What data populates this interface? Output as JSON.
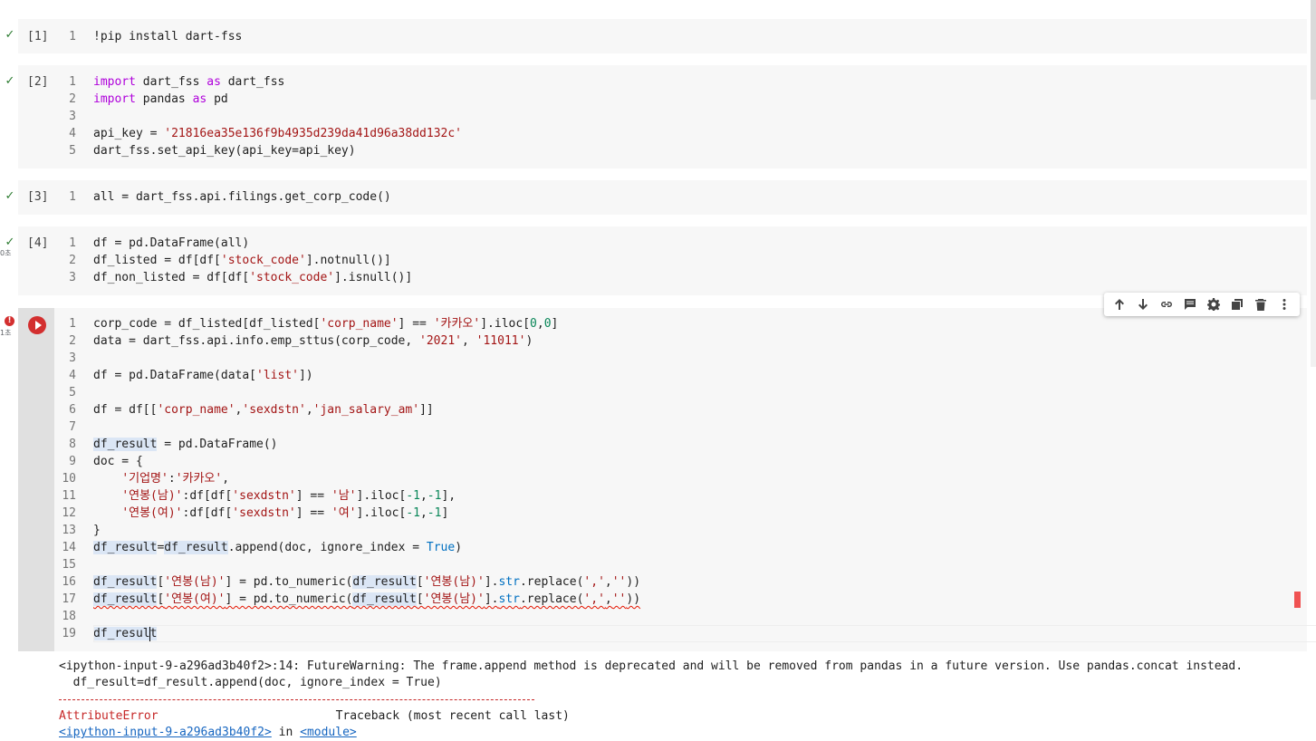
{
  "cells": [
    {
      "exec_count": "[1]",
      "status": "success",
      "lines": [
        {
          "n": "1",
          "parts": [
            {
              "t": "!pip install dart-fss",
              "c": ""
            }
          ]
        }
      ]
    },
    {
      "exec_count": "[2]",
      "status": "success",
      "lines": [
        {
          "n": "1",
          "parts": [
            {
              "t": "import",
              "c": "kw"
            },
            {
              "t": " dart_fss ",
              "c": ""
            },
            {
              "t": "as",
              "c": "kw"
            },
            {
              "t": " dart_fss",
              "c": ""
            }
          ]
        },
        {
          "n": "2",
          "parts": [
            {
              "t": "import",
              "c": "kw"
            },
            {
              "t": " pandas ",
              "c": ""
            },
            {
              "t": "as",
              "c": "kw"
            },
            {
              "t": " pd",
              "c": ""
            }
          ]
        },
        {
          "n": "3",
          "parts": []
        },
        {
          "n": "4",
          "parts": [
            {
              "t": "api_key = ",
              "c": ""
            },
            {
              "t": "'21816ea35e136f9b4935d239da41d96a38dd132c'",
              "c": "str"
            }
          ]
        },
        {
          "n": "5",
          "parts": [
            {
              "t": "dart_fss.set_api_key(api_key=api_key)",
              "c": ""
            }
          ]
        }
      ]
    },
    {
      "exec_count": "[3]",
      "status": "success",
      "lines": [
        {
          "n": "1",
          "parts": [
            {
              "t": "all = dart_fss.api.filings.get_corp_code()",
              "c": ""
            }
          ]
        }
      ]
    },
    {
      "exec_count": "[4]",
      "status": "success",
      "duration": "0초",
      "lines": [
        {
          "n": "1",
          "parts": [
            {
              "t": "df = pd.DataFrame(all)",
              "c": ""
            }
          ]
        },
        {
          "n": "2",
          "parts": [
            {
              "t": "df_listed = df[df[",
              "c": ""
            },
            {
              "t": "'stock_code'",
              "c": "str"
            },
            {
              "t": "].notnull()]",
              "c": ""
            }
          ]
        },
        {
          "n": "3",
          "parts": [
            {
              "t": "df_non_listed = df[df[",
              "c": ""
            },
            {
              "t": "'stock_code'",
              "c": "str"
            },
            {
              "t": "].isnull()]",
              "c": ""
            }
          ]
        }
      ]
    }
  ],
  "active_cell": {
    "status": "error",
    "duration": "1초",
    "lines": [
      {
        "n": "1",
        "parts": [
          {
            "t": "corp_code = df_listed[df_listed[",
            "c": ""
          },
          {
            "t": "'corp_name'",
            "c": "str"
          },
          {
            "t": "] == ",
            "c": ""
          },
          {
            "t": "'카카오'",
            "c": "str"
          },
          {
            "t": "].iloc[",
            "c": ""
          },
          {
            "t": "0",
            "c": "num"
          },
          {
            "t": ",",
            "c": ""
          },
          {
            "t": "0",
            "c": "num"
          },
          {
            "t": "]",
            "c": ""
          }
        ]
      },
      {
        "n": "2",
        "parts": [
          {
            "t": "data = dart_fss.api.info.emp_sttus(corp_code, ",
            "c": ""
          },
          {
            "t": "'2021'",
            "c": "str"
          },
          {
            "t": ", ",
            "c": ""
          },
          {
            "t": "'11011'",
            "c": "str"
          },
          {
            "t": ")",
            "c": ""
          }
        ]
      },
      {
        "n": "3",
        "parts": []
      },
      {
        "n": "4",
        "parts": [
          {
            "t": "df = pd.DataFrame(data[",
            "c": ""
          },
          {
            "t": "'list'",
            "c": "str"
          },
          {
            "t": "])",
            "c": ""
          }
        ]
      },
      {
        "n": "5",
        "parts": []
      },
      {
        "n": "6",
        "parts": [
          {
            "t": "df = df[[",
            "c": ""
          },
          {
            "t": "'corp_name'",
            "c": "str"
          },
          {
            "t": ",",
            "c": ""
          },
          {
            "t": "'sexdstn'",
            "c": "str"
          },
          {
            "t": ",",
            "c": ""
          },
          {
            "t": "'jan_salary_am'",
            "c": "str"
          },
          {
            "t": "]]",
            "c": ""
          }
        ]
      },
      {
        "n": "7",
        "parts": []
      },
      {
        "n": "8",
        "parts": [
          {
            "t": "df_result",
            "c": "hl"
          },
          {
            "t": " = pd.DataFrame()",
            "c": ""
          }
        ]
      },
      {
        "n": "9",
        "parts": [
          {
            "t": "doc = {",
            "c": ""
          }
        ]
      },
      {
        "n": "10",
        "parts": [
          {
            "t": "    ",
            "c": ""
          },
          {
            "t": "'기업명'",
            "c": "str"
          },
          {
            "t": ":",
            "c": ""
          },
          {
            "t": "'카카오'",
            "c": "str"
          },
          {
            "t": ",",
            "c": ""
          }
        ]
      },
      {
        "n": "11",
        "parts": [
          {
            "t": "    ",
            "c": ""
          },
          {
            "t": "'연봉(남)'",
            "c": "str"
          },
          {
            "t": ":df[df[",
            "c": ""
          },
          {
            "t": "'sexdstn'",
            "c": "str"
          },
          {
            "t": "] == ",
            "c": ""
          },
          {
            "t": "'남'",
            "c": "str"
          },
          {
            "t": "].iloc[",
            "c": ""
          },
          {
            "t": "-1",
            "c": "num"
          },
          {
            "t": ",",
            "c": ""
          },
          {
            "t": "-1",
            "c": "num"
          },
          {
            "t": "],",
            "c": ""
          }
        ]
      },
      {
        "n": "12",
        "parts": [
          {
            "t": "    ",
            "c": ""
          },
          {
            "t": "'연봉(여)'",
            "c": "str"
          },
          {
            "t": ":df[df[",
            "c": ""
          },
          {
            "t": "'sexdstn'",
            "c": "str"
          },
          {
            "t": "] == ",
            "c": ""
          },
          {
            "t": "'여'",
            "c": "str"
          },
          {
            "t": "].iloc[",
            "c": ""
          },
          {
            "t": "-1",
            "c": "num"
          },
          {
            "t": ",",
            "c": ""
          },
          {
            "t": "-1",
            "c": "num"
          },
          {
            "t": "]",
            "c": ""
          }
        ]
      },
      {
        "n": "13",
        "parts": [
          {
            "t": "}",
            "c": ""
          }
        ]
      },
      {
        "n": "14",
        "parts": [
          {
            "t": "df_result",
            "c": "hl"
          },
          {
            "t": "=",
            "c": ""
          },
          {
            "t": "df_result",
            "c": "hl"
          },
          {
            "t": ".append(doc, ignore_index = ",
            "c": ""
          },
          {
            "t": "True",
            "c": "bi"
          },
          {
            "t": ")",
            "c": ""
          }
        ]
      },
      {
        "n": "15",
        "parts": []
      },
      {
        "n": "16",
        "parts": [
          {
            "t": "df_result",
            "c": "hl"
          },
          {
            "t": "[",
            "c": ""
          },
          {
            "t": "'연봉(남)'",
            "c": "str"
          },
          {
            "t": "] = pd.to_numeric(",
            "c": ""
          },
          {
            "t": "df_result",
            "c": "hl"
          },
          {
            "t": "[",
            "c": ""
          },
          {
            "t": "'연봉(남)'",
            "c": "str"
          },
          {
            "t": "].",
            "c": ""
          },
          {
            "t": "str",
            "c": "bi"
          },
          {
            "t": ".replace(",
            "c": ""
          },
          {
            "t": "','",
            "c": "str"
          },
          {
            "t": ",",
            "c": ""
          },
          {
            "t": "''",
            "c": "str"
          },
          {
            "t": "))",
            "c": ""
          }
        ]
      },
      {
        "n": "17",
        "squiggle": true,
        "parts": [
          {
            "t": "df_result",
            "c": "hl"
          },
          {
            "t": "[",
            "c": ""
          },
          {
            "t": "'연봉(여)'",
            "c": "str"
          },
          {
            "t": "] = pd.to_numeric(",
            "c": ""
          },
          {
            "t": "df_result",
            "c": "hl"
          },
          {
            "t": "[",
            "c": ""
          },
          {
            "t": "'연봉(남)'",
            "c": "str"
          },
          {
            "t": "].",
            "c": ""
          },
          {
            "t": "str",
            "c": "bi"
          },
          {
            "t": ".replace(",
            "c": ""
          },
          {
            "t": "','",
            "c": "str"
          },
          {
            "t": ",",
            "c": ""
          },
          {
            "t": "''",
            "c": "str"
          },
          {
            "t": "))",
            "c": ""
          }
        ]
      },
      {
        "n": "18",
        "parts": []
      },
      {
        "n": "19",
        "parts": [
          {
            "t": "df_result",
            "c": "hl"
          }
        ]
      }
    ],
    "toolbar": [
      {
        "name": "move-up-icon"
      },
      {
        "name": "move-down-icon"
      },
      {
        "name": "link-icon"
      },
      {
        "name": "comment-icon"
      },
      {
        "name": "settings-icon"
      },
      {
        "name": "mirror-cell-icon"
      },
      {
        "name": "delete-icon"
      },
      {
        "name": "more-options-icon"
      }
    ]
  },
  "output": {
    "warning_line1": "<ipython-input-9-a296ad3b40f2>:14: FutureWarning: The frame.append method is deprecated and will be removed from pandas in a future version. Use pandas.concat instead.",
    "warning_line2": "  df_result=df_result.append(doc, ignore_index = True)",
    "error_name": "AttributeError",
    "traceback_header": "Traceback (most recent call last)",
    "frame_file": "<ipython-input-9-a296ad3b40f2>",
    "frame_in": " in ",
    "frame_module": "<module>"
  },
  "colors": {
    "check": "#2e7d32",
    "error": "#d32f2f",
    "string": "#a31515",
    "keyword": "#af00db"
  }
}
